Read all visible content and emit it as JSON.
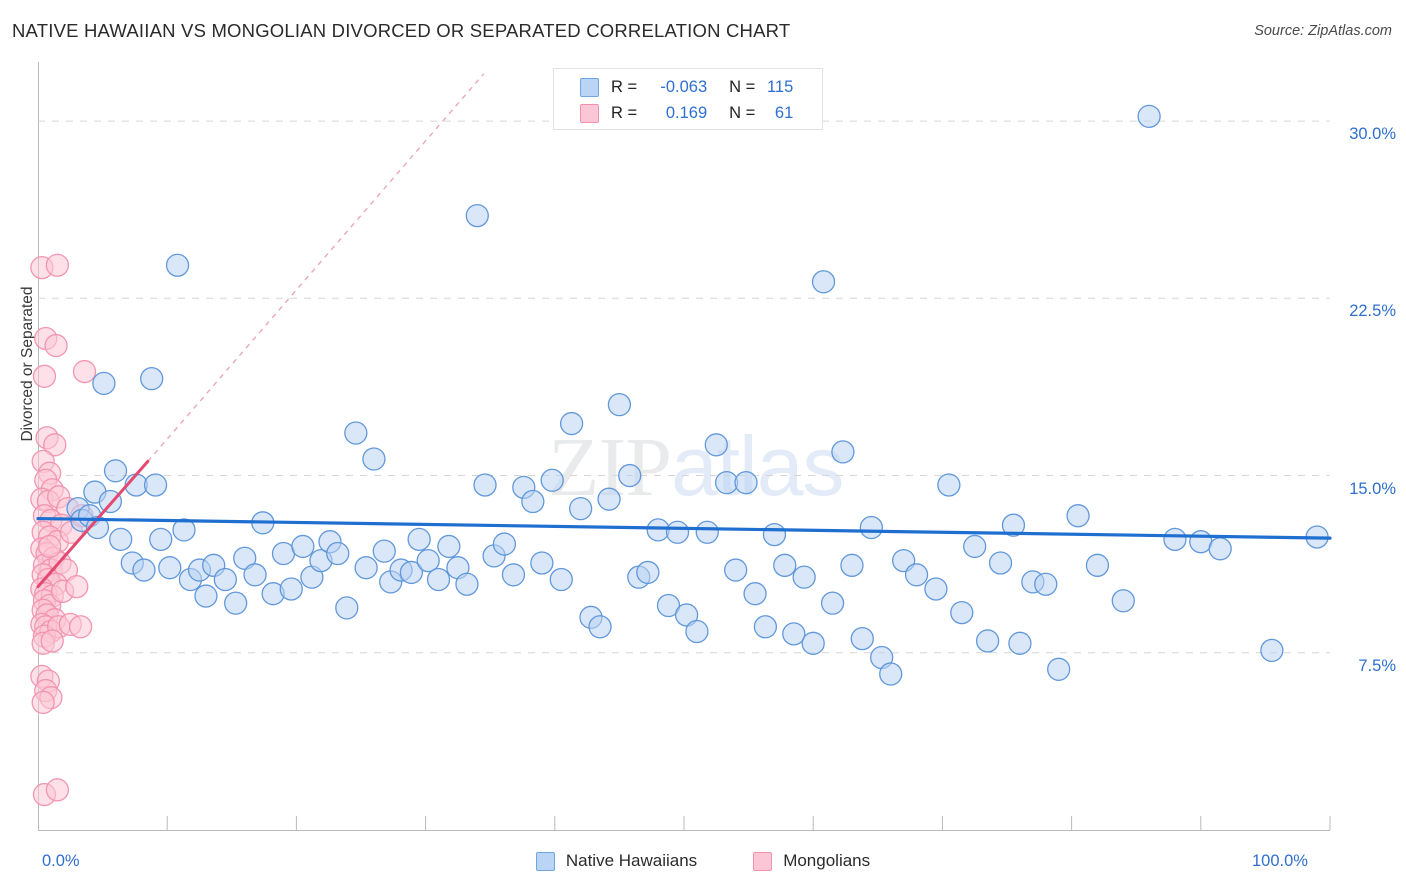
{
  "header": {
    "title": "NATIVE HAWAIIAN VS MONGOLIAN DIVORCED OR SEPARATED CORRELATION CHART",
    "source": "Source: ZipAtlas.com"
  },
  "watermark": {
    "part1": "ZIP",
    "part2": "atlas"
  },
  "stats": {
    "series1": {
      "r_label": "R =",
      "r_value": "-0.063",
      "n_label": "N =",
      "n_value": "115"
    },
    "series2": {
      "r_label": "R =",
      "r_value": "0.169",
      "n_label": "N =",
      "n_value": "61"
    }
  },
  "legend": {
    "items": [
      {
        "label": "Native Hawaiians",
        "color": "#b9d4f4",
        "border": "#6fa6e4"
      },
      {
        "label": "Mongolians",
        "color": "#fbc6d6",
        "border": "#f191ae"
      }
    ]
  },
  "chart_data": {
    "type": "scatter",
    "title": "NATIVE HAWAIIAN VS MONGOLIAN DIVORCED OR SEPARATED CORRELATION CHART",
    "xlabel": "",
    "ylabel": "Divorced or Separated",
    "xlim": [
      0,
      100
    ],
    "ylim": [
      0,
      32.5
    ],
    "grid": true,
    "x_ticks": [
      0,
      10,
      20,
      30,
      40,
      50,
      60,
      70,
      80,
      90,
      100
    ],
    "x_tick_labels": [
      "0.0%",
      "",
      "",
      "",
      "",
      "",
      "",
      "",
      "",
      "",
      "100.0%"
    ],
    "y_gridlines": [
      7.5,
      15.0,
      22.5,
      30.0
    ],
    "y_tick_labels": [
      "7.5%",
      "15.0%",
      "22.5%",
      "30.0%"
    ],
    "legend_position": "bottom",
    "series": [
      {
        "name": "Native Hawaiians",
        "color": "#b9d4f4",
        "border": "#5b93d8",
        "r": -0.063,
        "n": 115,
        "trendline": {
          "x0": 0,
          "y0": 13.18,
          "x1": 100,
          "y1": 12.35,
          "style": "solid",
          "color": "#1f6fd0"
        },
        "points": [
          [
            3.1,
            13.6
          ],
          [
            3.4,
            13.1
          ],
          [
            4.0,
            13.3
          ],
          [
            4.4,
            14.3
          ],
          [
            4.6,
            12.8
          ],
          [
            5.1,
            18.9
          ],
          [
            5.6,
            13.9
          ],
          [
            6.0,
            15.2
          ],
          [
            6.4,
            12.3
          ],
          [
            7.3,
            11.3
          ],
          [
            7.6,
            14.6
          ],
          [
            8.2,
            11.0
          ],
          [
            8.8,
            19.1
          ],
          [
            9.1,
            14.6
          ],
          [
            9.5,
            12.3
          ],
          [
            10.2,
            11.1
          ],
          [
            10.8,
            23.9
          ],
          [
            11.3,
            12.7
          ],
          [
            11.8,
            10.6
          ],
          [
            12.5,
            11.0
          ],
          [
            13.0,
            9.9
          ],
          [
            13.6,
            11.2
          ],
          [
            14.5,
            10.6
          ],
          [
            15.3,
            9.6
          ],
          [
            16.0,
            11.5
          ],
          [
            16.8,
            10.8
          ],
          [
            17.4,
            13.0
          ],
          [
            18.2,
            10.0
          ],
          [
            19.0,
            11.7
          ],
          [
            19.6,
            10.2
          ],
          [
            20.5,
            12.0
          ],
          [
            21.2,
            10.7
          ],
          [
            21.9,
            11.4
          ],
          [
            22.6,
            12.2
          ],
          [
            23.2,
            11.7
          ],
          [
            23.9,
            9.4
          ],
          [
            24.6,
            16.8
          ],
          [
            25.4,
            11.1
          ],
          [
            26.0,
            15.7
          ],
          [
            26.8,
            11.8
          ],
          [
            27.3,
            10.5
          ],
          [
            28.1,
            11.0
          ],
          [
            28.9,
            10.9
          ],
          [
            29.5,
            12.3
          ],
          [
            30.2,
            11.4
          ],
          [
            31.0,
            10.6
          ],
          [
            31.8,
            12.0
          ],
          [
            32.5,
            11.1
          ],
          [
            33.2,
            10.4
          ],
          [
            34.0,
            26.0
          ],
          [
            34.6,
            14.6
          ],
          [
            35.3,
            11.6
          ],
          [
            36.1,
            12.1
          ],
          [
            36.8,
            10.8
          ],
          [
            37.6,
            14.5
          ],
          [
            38.3,
            13.9
          ],
          [
            39.0,
            11.3
          ],
          [
            39.8,
            14.8
          ],
          [
            40.5,
            10.6
          ],
          [
            41.3,
            17.2
          ],
          [
            42.0,
            13.6
          ],
          [
            42.8,
            9.0
          ],
          [
            43.5,
            8.6
          ],
          [
            44.2,
            14.0
          ],
          [
            45.0,
            18.0
          ],
          [
            45.8,
            15.0
          ],
          [
            46.5,
            10.7
          ],
          [
            47.2,
            10.9
          ],
          [
            48.0,
            12.7
          ],
          [
            48.8,
            9.5
          ],
          [
            49.5,
            12.6
          ],
          [
            50.2,
            9.1
          ],
          [
            51.0,
            8.4
          ],
          [
            51.8,
            12.6
          ],
          [
            52.5,
            16.3
          ],
          [
            53.3,
            14.7
          ],
          [
            54.0,
            11.0
          ],
          [
            54.8,
            14.7
          ],
          [
            55.5,
            10.0
          ],
          [
            56.3,
            8.6
          ],
          [
            57.0,
            12.5
          ],
          [
            57.8,
            11.2
          ],
          [
            58.5,
            8.3
          ],
          [
            59.3,
            10.7
          ],
          [
            60.0,
            7.9
          ],
          [
            60.8,
            23.2
          ],
          [
            61.5,
            9.6
          ],
          [
            62.3,
            16.0
          ],
          [
            63.0,
            11.2
          ],
          [
            63.8,
            8.1
          ],
          [
            64.5,
            12.8
          ],
          [
            65.3,
            7.3
          ],
          [
            66.0,
            6.6
          ],
          [
            67.0,
            11.4
          ],
          [
            68.0,
            10.8
          ],
          [
            69.5,
            10.2
          ],
          [
            70.5,
            14.6
          ],
          [
            71.5,
            9.2
          ],
          [
            72.5,
            12.0
          ],
          [
            73.5,
            8.0
          ],
          [
            74.5,
            11.3
          ],
          [
            75.5,
            12.9
          ],
          [
            76.0,
            7.9
          ],
          [
            77.0,
            10.5
          ],
          [
            78.0,
            10.4
          ],
          [
            79.0,
            6.8
          ],
          [
            80.5,
            13.3
          ],
          [
            82.0,
            11.2
          ],
          [
            84.0,
            9.7
          ],
          [
            86.0,
            30.2
          ],
          [
            88.0,
            12.3
          ],
          [
            90.0,
            12.2
          ],
          [
            91.5,
            11.9
          ],
          [
            95.5,
            7.6
          ],
          [
            99.0,
            12.4
          ]
        ]
      },
      {
        "name": "Mongolians",
        "color": "#fbc6d6",
        "border": "#f191ae",
        "r": 0.169,
        "n": 61,
        "trendline": {
          "x0": 0,
          "y0": 10.3,
          "x1": 8.5,
          "y1": 15.6,
          "style": "solid",
          "color": "#e4496f"
        },
        "trendline_extension": {
          "x0": 8.5,
          "y0": 15.6,
          "x1": 34.5,
          "y1": 32.0,
          "style": "dashed",
          "color": "#e48aa5"
        },
        "points": [
          [
            0.3,
            23.8
          ],
          [
            1.5,
            23.9
          ],
          [
            0.6,
            20.8
          ],
          [
            1.4,
            20.5
          ],
          [
            0.5,
            19.2
          ],
          [
            3.6,
            19.4
          ],
          [
            0.7,
            16.6
          ],
          [
            1.3,
            16.3
          ],
          [
            0.4,
            15.6
          ],
          [
            0.9,
            15.1
          ],
          [
            0.6,
            14.8
          ],
          [
            1.1,
            14.4
          ],
          [
            0.3,
            14.0
          ],
          [
            0.8,
            13.9
          ],
          [
            1.6,
            14.1
          ],
          [
            2.3,
            13.6
          ],
          [
            0.5,
            13.3
          ],
          [
            1.0,
            13.1
          ],
          [
            1.8,
            12.9
          ],
          [
            0.4,
            12.6
          ],
          [
            0.9,
            12.4
          ],
          [
            1.5,
            12.2
          ],
          [
            2.6,
            12.6
          ],
          [
            3.4,
            13.3
          ],
          [
            0.3,
            11.9
          ],
          [
            0.7,
            11.7
          ],
          [
            1.2,
            11.5
          ],
          [
            0.5,
            11.2
          ],
          [
            1.0,
            11.0
          ],
          [
            1.7,
            11.3
          ],
          [
            2.2,
            11.0
          ],
          [
            0.4,
            10.8
          ],
          [
            0.8,
            10.6
          ],
          [
            1.4,
            10.4
          ],
          [
            0.3,
            10.2
          ],
          [
            0.6,
            10.0
          ],
          [
            1.1,
            9.9
          ],
          [
            0.5,
            9.7
          ],
          [
            0.9,
            9.5
          ],
          [
            1.9,
            10.1
          ],
          [
            3.0,
            10.3
          ],
          [
            0.4,
            9.3
          ],
          [
            0.7,
            9.1
          ],
          [
            1.3,
            8.9
          ],
          [
            0.3,
            8.7
          ],
          [
            0.6,
            8.6
          ],
          [
            1.0,
            8.4
          ],
          [
            0.5,
            8.2
          ],
          [
            1.6,
            8.6
          ],
          [
            2.5,
            8.7
          ],
          [
            3.3,
            8.6
          ],
          [
            0.4,
            7.9
          ],
          [
            1.1,
            8.0
          ],
          [
            0.3,
            6.5
          ],
          [
            0.8,
            6.3
          ],
          [
            0.6,
            5.9
          ],
          [
            1.0,
            5.6
          ],
          [
            0.4,
            5.4
          ],
          [
            0.5,
            1.5
          ],
          [
            1.5,
            1.7
          ],
          [
            0.9,
            12.0
          ]
        ]
      }
    ]
  }
}
